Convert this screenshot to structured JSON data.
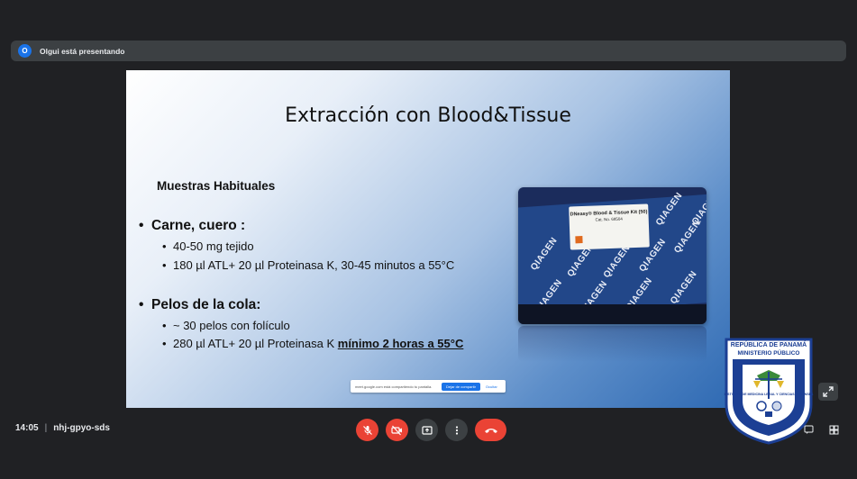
{
  "banner": {
    "avatar_letter": "O",
    "text": "Olgui está presentando"
  },
  "slide": {
    "title": "Extracción con Blood&Tissue",
    "section_heading": "Muestras Habituales",
    "groups": [
      {
        "bullet": "Carne, cuero :",
        "items": [
          "40-50 mg tejido",
          "180 µl ATL+ 20 µl Proteinasa K, 30-45 minutos a 55°C"
        ]
      },
      {
        "bullet": "Pelos de la cola:",
        "items": [
          "~ 30 pelos con folículo",
          "280 µl ATL+ 20 µl Proteinasa K "
        ],
        "emphasis": "mínimo 2 horas a 55°C"
      }
    ],
    "photo": {
      "kit_line1": "DNeasy® Blood & Tissue Kit (50)",
      "kit_line2": "Cat. No. 69504",
      "brand": "QIAGEN"
    },
    "share_notice": {
      "message": "meet.google.com está compartiendo tu pantalla.",
      "stop_label": "Dejar de compartir",
      "hide_label": "Ocultar"
    }
  },
  "emblem": {
    "top_line1": "REPÚBLICA DE PANAMÁ",
    "top_line2": "MINISTERIO PÚBLICO",
    "ring_text": "INSTITUTO DE MEDICINA LEGAL Y CIENCIAS FORENSES"
  },
  "bottom": {
    "time": "14:05",
    "separator": "|",
    "meeting_code": "nhj-gpyo-sds"
  },
  "icons": {
    "mic": "mic-off-icon",
    "camera": "camera-off-icon",
    "present": "present-screen-icon",
    "more": "more-options-icon",
    "hangup": "hangup-icon"
  },
  "colors": {
    "accent": "#1a73e8",
    "danger": "#ea4335",
    "background": "#202124",
    "control": "#3c4043"
  }
}
